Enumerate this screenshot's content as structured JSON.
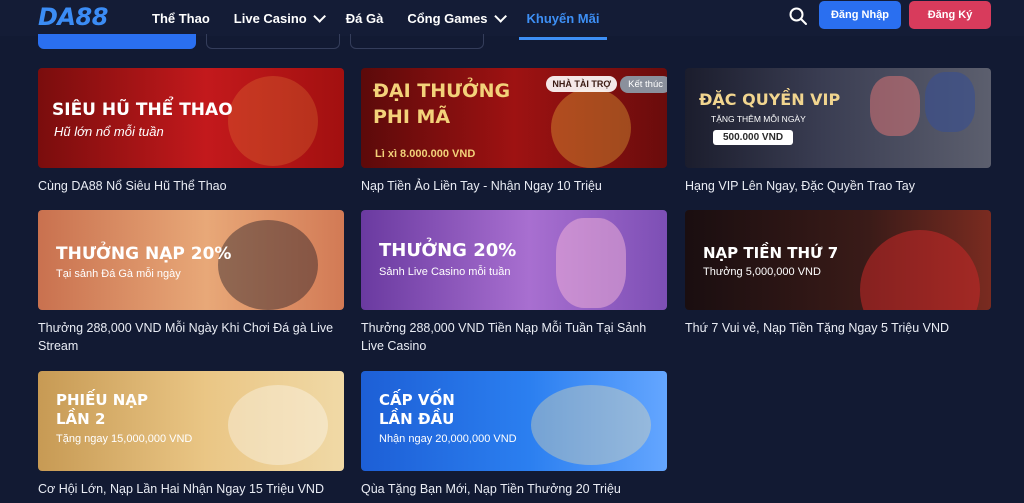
{
  "header": {
    "logo": "DA88",
    "nav": [
      {
        "label": "Thể Thao",
        "dropdown": false,
        "active": false
      },
      {
        "label": "Live Casino",
        "dropdown": true,
        "active": false
      },
      {
        "label": "Đá Gà",
        "dropdown": false,
        "active": false
      },
      {
        "label": "Cổng Games",
        "dropdown": true,
        "active": false
      },
      {
        "label": "Khuyến Mãi",
        "dropdown": false,
        "active": true
      }
    ],
    "login_label": "Đăng Nhập",
    "register_label": "Đăng Ký"
  },
  "promotions": [
    {
      "banner_title": "SIÊU HŨ THỂ THAO",
      "banner_sub": "Hũ lớn nổ mỗi tuần",
      "caption": "Cùng DA88 Nổ Siêu Hũ Thể Thao"
    },
    {
      "banner_title": "ĐẠI THƯỞNG PHI MÃ",
      "banner_sub": "Lì xì 8.000.000 VND",
      "tag_sponsor": "NHÀ TÀI TRỢ",
      "tag_status": "Kết thúc",
      "caption": "Nạp Tiền Ảo Liền Tay - Nhận Ngay 10 Triệu"
    },
    {
      "banner_title": "ĐẶC QUYỀN VIP",
      "banner_sub": "TẶNG THÊM MỖI NGÀY",
      "banner_pill": "500.000 VND",
      "caption": "Hạng VIP Lên Ngay, Đặc Quyền Trao Tay"
    },
    {
      "banner_title": "THƯỞNG NẠP 20%",
      "banner_sub": "Tại sảnh Đá Gà mỗi ngày",
      "caption": "Thưởng 288,000 VND Mỗi Ngày Khi Chơi Đá gà Live Stream"
    },
    {
      "banner_title": "THƯỞNG 20%",
      "banner_sub": "Sảnh Live Casino mỗi tuần",
      "caption": "Thưởng 288,000 VND Tiền Nạp Mỗi Tuần Tại Sảnh Live Casino"
    },
    {
      "banner_title": "NẠP TIỀN THỨ 7",
      "banner_sub": "Thưởng 5,000,000 VND",
      "caption": "Thứ 7 Vui vẻ, Nạp Tiền Tặng Ngay 5 Triệu VND"
    },
    {
      "banner_title": "PHIẾU NẠP LẦN 2",
      "banner_sub": "Tặng ngay 15,000,000 VND",
      "caption": "Cơ Hội Lớn, Nạp Lần Hai Nhận Ngay 15 Triệu VND"
    },
    {
      "banner_title": "CẤP VỐN LẦN ĐẦU",
      "banner_sub": "Nhận ngay 20,000,000 VND",
      "caption": "Qùa Tặng Bạn Mới, Nạp Tiền Thưởng 20 Triệu"
    }
  ],
  "icons": {
    "search": "search-icon",
    "chevron": "chevron-down-icon"
  },
  "colors": {
    "bg": "#121a33",
    "accent": "#3d8ff5",
    "login": "#2a6ff0",
    "register": "#d83b5c"
  }
}
